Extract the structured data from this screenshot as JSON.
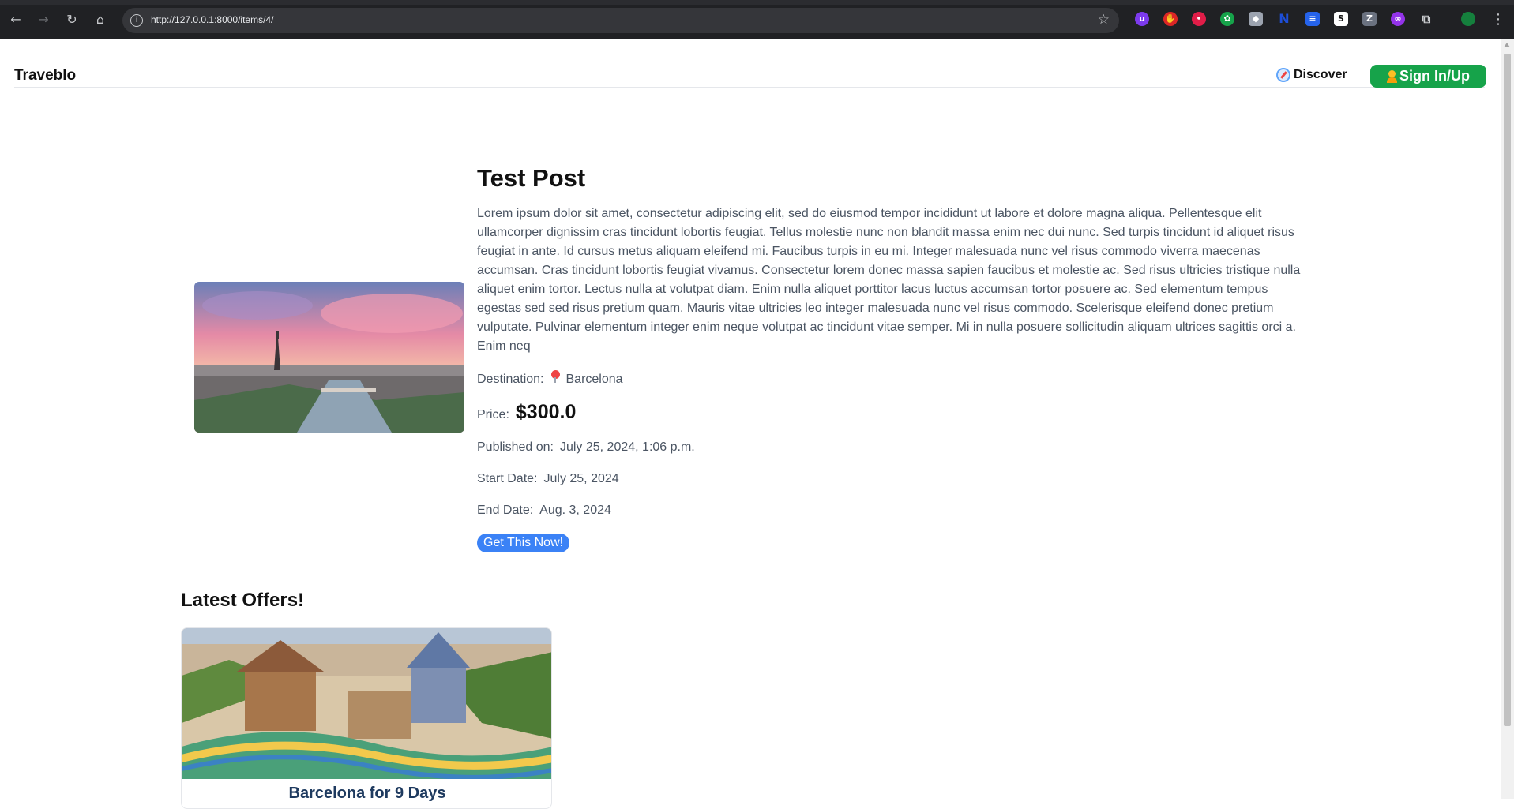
{
  "browser": {
    "url": "http://127.0.0.1:8000/items/4/",
    "extensions": [
      "ublock-icon",
      "adblock-icon",
      "lastpass-icon",
      "chatgpt-icon",
      "privacy-badger-icon",
      "notion-icon",
      "translate-icon",
      "s-icon",
      "zotero-icon",
      "ai-icon",
      "extensions-icon"
    ],
    "profile_label": "profile"
  },
  "nav": {
    "brand": "Traveblo",
    "discover": "Discover",
    "signin": "Sign In/Up"
  },
  "post": {
    "title": "Test Post",
    "body": "Lorem ipsum dolor sit amet, consectetur adipiscing elit, sed do eiusmod tempor incididunt ut labore et dolore magna aliqua. Pellentesque elit ullamcorper dignissim cras tincidunt lobortis feugiat. Tellus molestie nunc non blandit massa enim nec dui nunc. Sed turpis tincidunt id aliquet risus feugiat in ante. Id cursus metus aliquam eleifend mi. Faucibus turpis in eu mi. Integer malesuada nunc vel risus commodo viverra maecenas accumsan. Cras tincidunt lobortis feugiat vivamus. Consectetur lorem donec massa sapien faucibus et molestie ac. Sed risus ultricies tristique nulla aliquet enim tortor. Lectus nulla at volutpat diam. Enim nulla aliquet porttitor lacus luctus accumsan tortor posuere ac. Sed elementum tempus egestas sed sed risus pretium quam. Mauris vitae ultricies leo integer malesuada nunc vel risus commodo. Scelerisque eleifend donec pretium vulputate. Pulvinar elementum integer enim neque volutpat ac tincidunt vitae semper. Mi in nulla posuere sollicitudin aliquam ultrices sagittis orci a. Enim neq",
    "destination_label": "Destination:",
    "destination": "Barcelona",
    "price_label": "Price:",
    "price": "$300.0",
    "published_label": "Published on:",
    "published": "July 25, 2024, 1:06 p.m.",
    "start_label": "Start Date:",
    "start": "July 25, 2024",
    "end_label": "End Date:",
    "end": "Aug. 3, 2024",
    "cta": "Get This Now!"
  },
  "offers": {
    "title": "Latest Offers!",
    "items": [
      {
        "title": "Barcelona for 9 Days"
      }
    ]
  },
  "colors": {
    "signin_bg": "#16a34a",
    "cta_bg": "#3b82f6"
  }
}
